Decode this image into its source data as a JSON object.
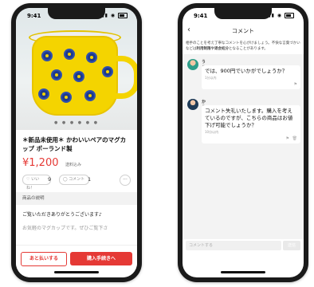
{
  "left_screen": {
    "status_bar": {
      "time": "9:41"
    },
    "carousel_dots": "● ● ● ● ● ●",
    "product": {
      "title": "＊新品未使用＊ かわいいペアのマグカップ ポーランド製",
      "price": "¥1,200",
      "shipping": "送料込み"
    },
    "actions": {
      "like_label": "♡ いいね！",
      "like_count": "9",
      "comment_label": "◯ コメント",
      "comment_count": "1",
      "more_label": "···"
    },
    "section_label": "商品の説明",
    "description": "ご覧いただきありがとうございます♪",
    "description_more": "お気軽のマグカップです。ぜひご覧下さ",
    "buttons": {
      "later": "あと払いする",
      "buy": "購入手続きへ"
    },
    "colors": {
      "accent": "#e53935",
      "mug": "#f4d400",
      "flower": "#1e3a8a"
    }
  },
  "right_screen": {
    "status_bar": {
      "time": "9:41"
    },
    "nav": {
      "back_icon": "‹",
      "title": "コメント"
    },
    "notice_prefix": "相手のことを考え丁寧なコメントを心がけましょう。不快な言葉づかいなどは",
    "notice_bold": "利用制限や退会処分",
    "notice_suffix": "となることがあります。",
    "comments": [
      {
        "name": "うるやま",
        "text": "では、900円でいかがでしょうか？",
        "time": "1分以内"
      },
      {
        "name": "かうわか",
        "text": "コメント失礼いたします。購入を考えているのですが、こちらの商品はお値下げ可能でしょうか？",
        "time": "10分以内"
      }
    ],
    "input": {
      "placeholder": "コメントする",
      "send_label": "送信"
    }
  }
}
